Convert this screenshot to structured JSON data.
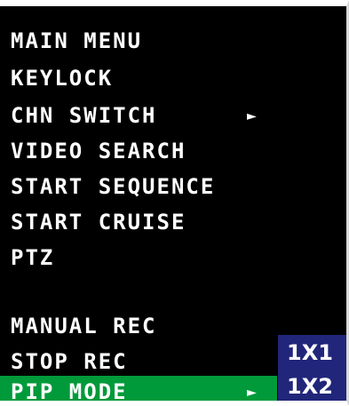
{
  "menu": {
    "items": [
      {
        "label": "MAIN MENU"
      },
      {
        "label": "KEYLOCK"
      },
      {
        "label": "CHN SWITCH",
        "arrow": "►"
      },
      {
        "label": "VIDEO SEARCH"
      },
      {
        "label": "START SEQUENCE"
      },
      {
        "label": "START CRUISE"
      },
      {
        "label": "PTZ"
      },
      {
        "label": ""
      },
      {
        "label": "MANUAL REC"
      },
      {
        "label": "STOP REC"
      },
      {
        "label": "PIP MODE",
        "arrow": "►",
        "selected": true
      }
    ]
  },
  "submenu": {
    "items": [
      {
        "label": "1X1"
      },
      {
        "label": "1X2"
      }
    ]
  },
  "colors": {
    "background": "#000000",
    "text": "#ffffff",
    "selected_highlight": "#009a3a",
    "submenu_background": "#22267a"
  },
  "icons": {
    "submenu_arrow": "right-triangle-icon"
  }
}
